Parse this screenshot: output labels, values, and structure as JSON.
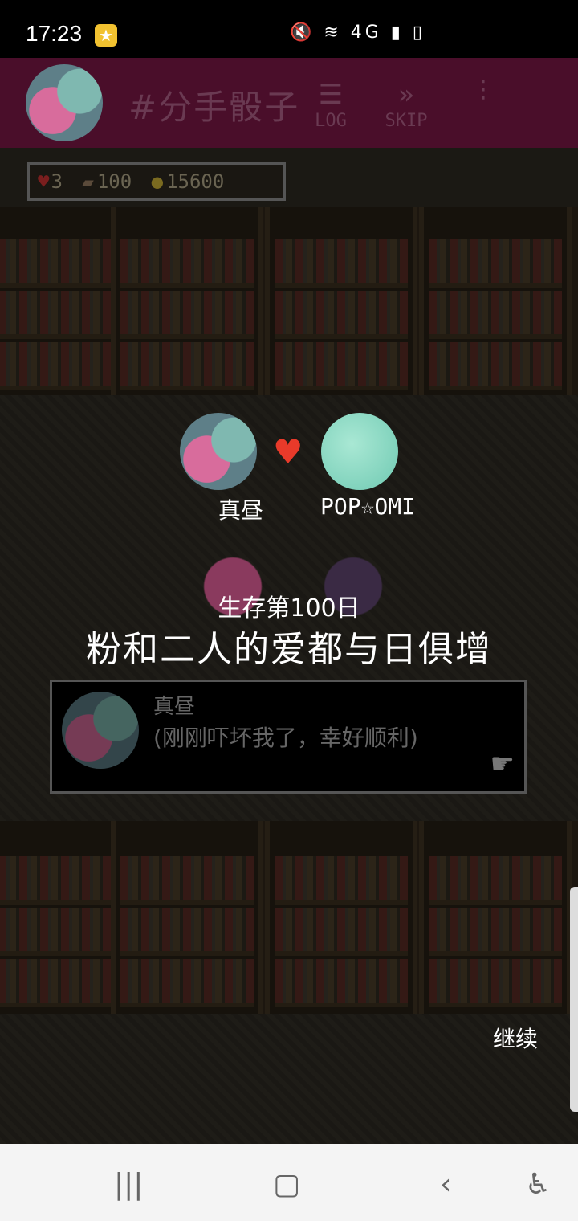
{
  "status_bar": {
    "time": "17:23",
    "notif_icon": "star-badge-icon",
    "system_icons": "mute wifi 4G signal battery"
  },
  "header": {
    "title": "#分手骰子",
    "log_label": "LOG",
    "skip_label": "SKIP"
  },
  "resources": {
    "hearts": "3",
    "tickets": "100",
    "coins": "15600"
  },
  "couple": {
    "left_name": "真昼",
    "right_name": "POP☆OMI"
  },
  "event": {
    "day": "生存第100日",
    "headline": "粉和二人的爱都与日俱增"
  },
  "dialog": {
    "speaker": "真昼",
    "text": "(刚刚吓坏我了，幸好顺利)"
  },
  "continue_label": "继续",
  "colors": {
    "topbar": "#4a0e2a",
    "heart": "#e83a2a"
  }
}
